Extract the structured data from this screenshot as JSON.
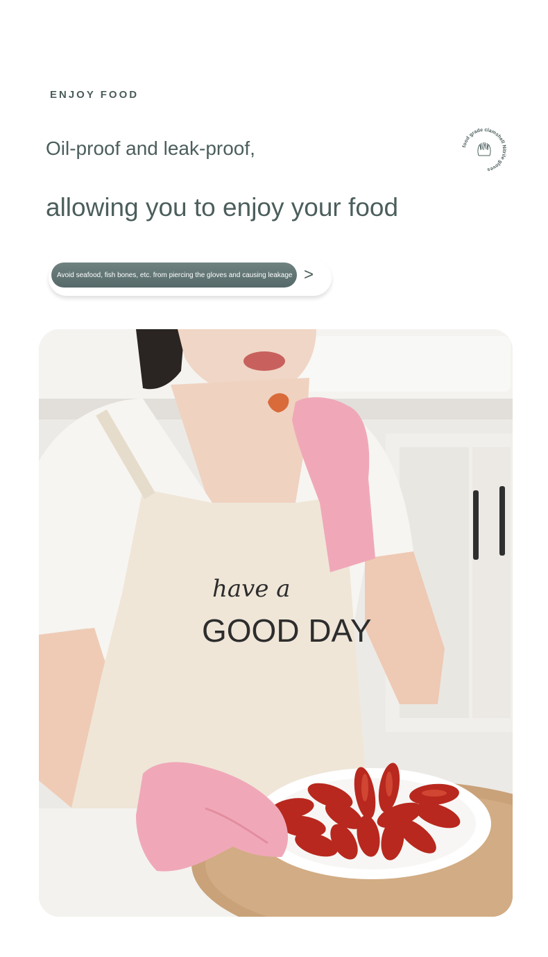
{
  "header": {
    "eyebrow": "ENJOY FOOD",
    "line1": "Oil-proof and leak-proof,",
    "line2": "allowing you to enjoy your food"
  },
  "seal": {
    "text": "food grade clamshell Nitrile gloves"
  },
  "pill": {
    "text": "Avoid seafood, fish bones, etc. from piercing the gloves and causing leakage",
    "arrow": ">"
  },
  "photo": {
    "apron_line1": "have a",
    "apron_line2": "GOOD DAY"
  },
  "colors": {
    "text_primary": "#4b5e5c",
    "pill_bg": "#5f7372",
    "glove_pink": "#f0a8b8",
    "crayfish_red": "#b8281e"
  }
}
